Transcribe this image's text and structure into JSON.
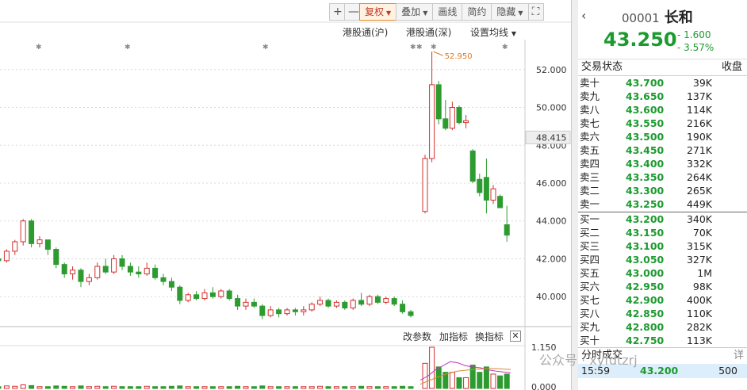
{
  "toolbar": {
    "zoom_in": "+",
    "zoom_out": "—",
    "restore": "复权",
    "overlay": "叠加",
    "draw": "画线",
    "simple": "简约",
    "hide": "隐藏",
    "fullscreen": "⛶"
  },
  "chart_links": {
    "hk_connect_sh": "港股通(沪)",
    "hk_connect_sz": "港股通(深)",
    "ma_settings": "设置均线"
  },
  "indicator_bar": {
    "change_params": "改参数",
    "add_indicator": "加指标",
    "switch_indicator": "换指标"
  },
  "quote": {
    "code": "00001",
    "name": "长和",
    "price": "43.250",
    "change": "- 1.600",
    "change_pct": "- 3.57%"
  },
  "orderbook": {
    "status_label": "交易状态",
    "status_value": "收盘",
    "asks": [
      {
        "label": "卖十",
        "price": "43.700",
        "vol": "39K"
      },
      {
        "label": "卖九",
        "price": "43.650",
        "vol": "137K"
      },
      {
        "label": "卖八",
        "price": "43.600",
        "vol": "114K"
      },
      {
        "label": "卖七",
        "price": "43.550",
        "vol": "216K"
      },
      {
        "label": "卖六",
        "price": "43.500",
        "vol": "190K"
      },
      {
        "label": "卖五",
        "price": "43.450",
        "vol": "271K"
      },
      {
        "label": "卖四",
        "price": "43.400",
        "vol": "332K"
      },
      {
        "label": "卖三",
        "price": "43.350",
        "vol": "264K"
      },
      {
        "label": "卖二",
        "price": "43.300",
        "vol": "265K"
      },
      {
        "label": "卖一",
        "price": "43.250",
        "vol": "449K"
      }
    ],
    "bids": [
      {
        "label": "买一",
        "price": "43.200",
        "vol": "340K"
      },
      {
        "label": "买二",
        "price": "43.150",
        "vol": "70K"
      },
      {
        "label": "买三",
        "price": "43.100",
        "vol": "315K"
      },
      {
        "label": "买四",
        "price": "43.050",
        "vol": "327K"
      },
      {
        "label": "买五",
        "price": "43.000",
        "vol": "1M"
      },
      {
        "label": "买六",
        "price": "42.950",
        "vol": "98K"
      },
      {
        "label": "买七",
        "price": "42.900",
        "vol": "400K"
      },
      {
        "label": "买八",
        "price": "42.850",
        "vol": "110K"
      },
      {
        "label": "买九",
        "price": "42.800",
        "vol": "282K"
      },
      {
        "label": "买十",
        "price": "42.750",
        "vol": "113K"
      }
    ]
  },
  "trades": {
    "header": "分时成交",
    "more": "详",
    "rows": [
      {
        "time": "15:59",
        "price": "43.200",
        "vol": "500"
      }
    ]
  },
  "watermark": "公众号 · xyfdtzrj",
  "chart_data": {
    "type": "candlestick",
    "y_ticks": [
      "52.000",
      "50.000",
      "48.000",
      "46.000",
      "44.000",
      "42.000",
      "40.000"
    ],
    "crosshair_price": "48.415",
    "max_label": "52.950",
    "volume_ticks": [
      "1.150",
      "0.000"
    ],
    "ylim": [
      38.5,
      53.5
    ],
    "candles": [
      {
        "o": 42.0,
        "h": 42.2,
        "l": 41.6,
        "c": 41.9
      },
      {
        "o": 41.9,
        "h": 42.5,
        "l": 41.8,
        "c": 42.4
      },
      {
        "o": 42.4,
        "h": 43.0,
        "l": 42.2,
        "c": 42.9
      },
      {
        "o": 42.9,
        "h": 44.1,
        "l": 42.7,
        "c": 44.0
      },
      {
        "o": 44.0,
        "h": 44.1,
        "l": 42.6,
        "c": 42.8
      },
      {
        "o": 42.8,
        "h": 43.2,
        "l": 42.6,
        "c": 43.0
      },
      {
        "o": 43.0,
        "h": 43.0,
        "l": 42.2,
        "c": 42.5
      },
      {
        "o": 42.5,
        "h": 42.6,
        "l": 41.5,
        "c": 41.7
      },
      {
        "o": 41.7,
        "h": 41.8,
        "l": 41.0,
        "c": 41.2
      },
      {
        "o": 41.2,
        "h": 41.6,
        "l": 40.9,
        "c": 41.4
      },
      {
        "o": 41.4,
        "h": 41.5,
        "l": 40.5,
        "c": 40.8
      },
      {
        "o": 40.8,
        "h": 41.2,
        "l": 40.6,
        "c": 41.0
      },
      {
        "o": 41.0,
        "h": 41.8,
        "l": 40.9,
        "c": 41.6
      },
      {
        "o": 41.6,
        "h": 42.0,
        "l": 41.2,
        "c": 41.3
      },
      {
        "o": 41.3,
        "h": 42.2,
        "l": 41.2,
        "c": 42.0
      },
      {
        "o": 42.0,
        "h": 42.2,
        "l": 41.4,
        "c": 41.6
      },
      {
        "o": 41.6,
        "h": 41.8,
        "l": 41.1,
        "c": 41.3
      },
      {
        "o": 41.3,
        "h": 41.6,
        "l": 41.0,
        "c": 41.2
      },
      {
        "o": 41.2,
        "h": 41.8,
        "l": 41.1,
        "c": 41.5
      },
      {
        "o": 41.5,
        "h": 41.7,
        "l": 40.9,
        "c": 41.0
      },
      {
        "o": 41.0,
        "h": 41.2,
        "l": 40.6,
        "c": 40.8
      },
      {
        "o": 40.8,
        "h": 41.0,
        "l": 40.3,
        "c": 40.5
      },
      {
        "o": 40.5,
        "h": 40.6,
        "l": 39.6,
        "c": 39.8
      },
      {
        "o": 39.8,
        "h": 40.2,
        "l": 39.7,
        "c": 40.1
      },
      {
        "o": 40.1,
        "h": 40.3,
        "l": 39.8,
        "c": 39.9
      },
      {
        "o": 39.9,
        "h": 40.4,
        "l": 39.8,
        "c": 40.2
      },
      {
        "o": 40.2,
        "h": 40.5,
        "l": 39.9,
        "c": 40.0
      },
      {
        "o": 40.0,
        "h": 40.4,
        "l": 39.9,
        "c": 40.3
      },
      {
        "o": 40.3,
        "h": 40.4,
        "l": 39.8,
        "c": 39.9
      },
      {
        "o": 39.9,
        "h": 40.1,
        "l": 39.3,
        "c": 39.5
      },
      {
        "o": 39.5,
        "h": 39.9,
        "l": 39.3,
        "c": 39.7
      },
      {
        "o": 39.7,
        "h": 39.9,
        "l": 39.4,
        "c": 39.5
      },
      {
        "o": 39.5,
        "h": 39.6,
        "l": 38.8,
        "c": 39.0
      },
      {
        "o": 39.0,
        "h": 39.5,
        "l": 38.9,
        "c": 39.3
      },
      {
        "o": 39.3,
        "h": 39.4,
        "l": 38.9,
        "c": 39.1
      },
      {
        "o": 39.1,
        "h": 39.4,
        "l": 39.0,
        "c": 39.3
      },
      {
        "o": 39.3,
        "h": 39.4,
        "l": 39.0,
        "c": 39.2
      },
      {
        "o": 39.2,
        "h": 39.5,
        "l": 39.0,
        "c": 39.3
      },
      {
        "o": 39.3,
        "h": 39.7,
        "l": 39.2,
        "c": 39.6
      },
      {
        "o": 39.6,
        "h": 40.0,
        "l": 39.5,
        "c": 39.8
      },
      {
        "o": 39.8,
        "h": 39.9,
        "l": 39.4,
        "c": 39.5
      },
      {
        "o": 39.5,
        "h": 39.8,
        "l": 39.4,
        "c": 39.7
      },
      {
        "o": 39.7,
        "h": 39.8,
        "l": 39.3,
        "c": 39.4
      },
      {
        "o": 39.4,
        "h": 39.9,
        "l": 39.3,
        "c": 39.8
      },
      {
        "o": 39.8,
        "h": 40.2,
        "l": 39.5,
        "c": 39.6
      },
      {
        "o": 39.6,
        "h": 40.1,
        "l": 39.5,
        "c": 40.0
      },
      {
        "o": 40.0,
        "h": 40.1,
        "l": 39.6,
        "c": 39.7
      },
      {
        "o": 39.7,
        "h": 40.0,
        "l": 39.6,
        "c": 39.9
      },
      {
        "o": 39.9,
        "h": 40.0,
        "l": 39.5,
        "c": 39.6
      },
      {
        "o": 39.6,
        "h": 39.8,
        "l": 39.1,
        "c": 39.2
      },
      {
        "o": 39.2,
        "h": 39.3,
        "l": 38.9,
        "c": 39.0
      },
      {
        "o": 44.5,
        "h": 47.5,
        "l": 44.4,
        "c": 47.3
      },
      {
        "o": 47.3,
        "h": 52.95,
        "l": 47.1,
        "c": 51.2
      },
      {
        "o": 51.2,
        "h": 51.4,
        "l": 49.1,
        "c": 49.4
      },
      {
        "o": 49.4,
        "h": 50.4,
        "l": 48.8,
        "c": 48.9
      },
      {
        "o": 48.9,
        "h": 50.3,
        "l": 48.8,
        "c": 50.0
      },
      {
        "o": 50.0,
        "h": 50.1,
        "l": 49.1,
        "c": 49.2
      },
      {
        "o": 49.2,
        "h": 49.6,
        "l": 48.9,
        "c": 49.3
      },
      {
        "o": 47.7,
        "h": 47.8,
        "l": 46.0,
        "c": 46.1
      },
      {
        "o": 46.2,
        "h": 46.5,
        "l": 45.3,
        "c": 45.5
      },
      {
        "o": 46.3,
        "h": 47.3,
        "l": 44.4,
        "c": 45.1
      },
      {
        "o": 45.1,
        "h": 45.9,
        "l": 44.9,
        "c": 45.7
      },
      {
        "o": 45.3,
        "h": 45.4,
        "l": 44.7,
        "c": 44.7
      },
      {
        "o": 43.8,
        "h": 44.8,
        "l": 42.9,
        "c": 43.25
      }
    ],
    "volumes": [
      0.05,
      0.07,
      0.06,
      0.1,
      0.08,
      0.05,
      0.05,
      0.07,
      0.06,
      0.05,
      0.07,
      0.05,
      0.06,
      0.05,
      0.06,
      0.05,
      0.05,
      0.05,
      0.06,
      0.05,
      0.05,
      0.06,
      0.07,
      0.05,
      0.05,
      0.05,
      0.05,
      0.05,
      0.05,
      0.06,
      0.05,
      0.05,
      0.07,
      0.05,
      0.05,
      0.05,
      0.05,
      0.05,
      0.05,
      0.06,
      0.05,
      0.05,
      0.05,
      0.05,
      0.06,
      0.05,
      0.05,
      0.05,
      0.05,
      0.06,
      0.05,
      0.7,
      1.15,
      0.6,
      0.45,
      0.45,
      0.3,
      0.3,
      0.65,
      0.45,
      0.6,
      0.4,
      0.35,
      0.4
    ],
    "ma": [
      [
        0.2,
        0.3,
        0.45,
        0.55,
        0.65,
        0.62,
        0.55,
        0.52,
        0.5,
        0.45,
        0.42,
        0.4,
        0.38
      ],
      [
        0.1,
        0.18,
        0.25,
        0.32,
        0.38,
        0.42,
        0.44,
        0.46,
        0.47,
        0.48,
        0.48,
        0.47,
        0.46
      ]
    ]
  }
}
